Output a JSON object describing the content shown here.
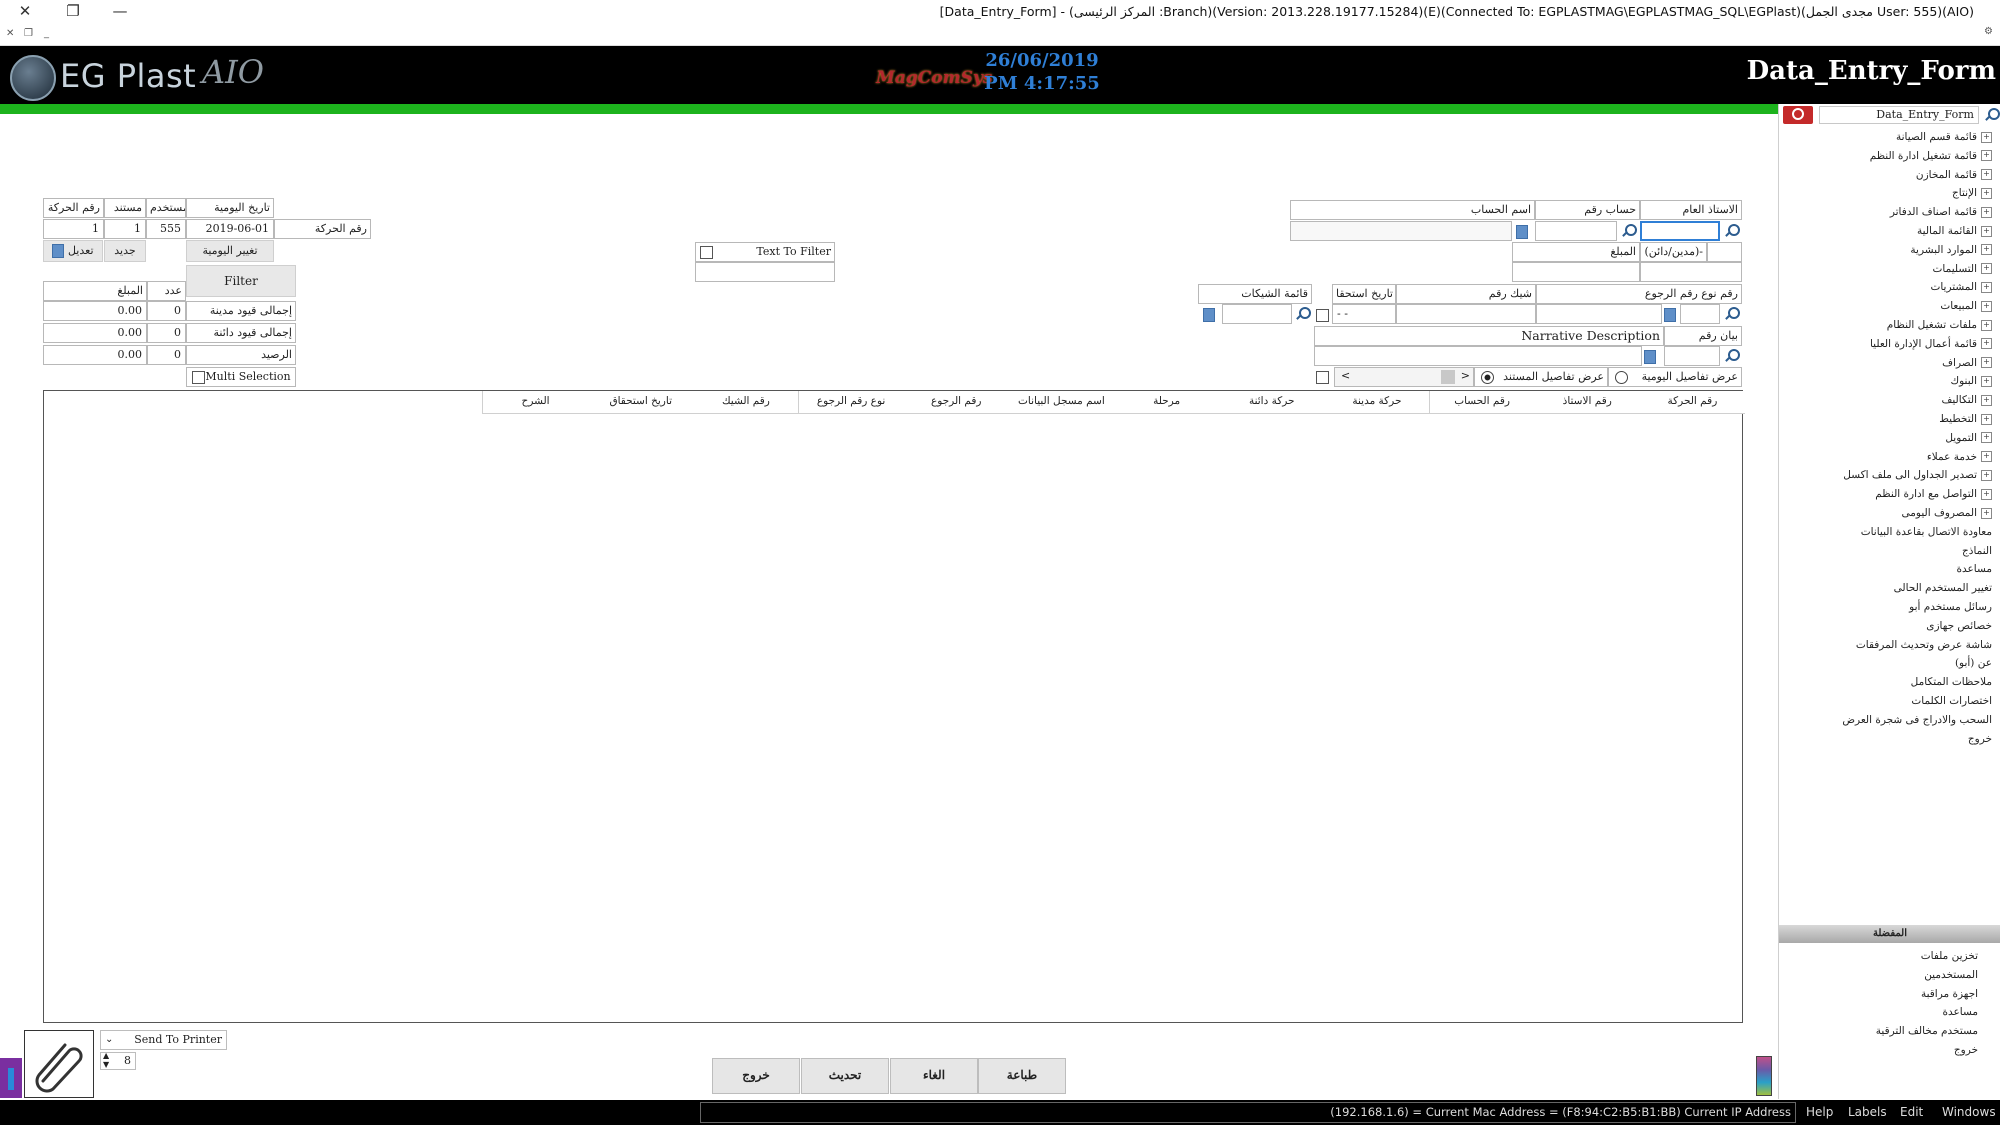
{
  "window": {
    "title": "[Data_Entry_Form] - (المركز الرئيسى :Branch)(Version: 2013.228.19177.15284)(E)(Connected To: EGPLASTMAG\\EGPLASTMAG_SQL\\EGPlast)(مجدى الجمل User: 555)(AIO)",
    "close_glyph": "✕",
    "restore_glyph": "❐",
    "minimize_glyph": "—"
  },
  "header": {
    "logo_text": "EG Plast",
    "logo_script": "AIO",
    "center_logo": "MagComSys",
    "date": "26/06/2019",
    "time": "PM 4:17:55",
    "form_title": "Data_Entry_Form"
  },
  "left_panel": {
    "col_labels": {
      "trans_no": "رقم الحركة",
      "doc": "مستند",
      "user": "مستخدم",
      "journal_date": "تاريخ اليومية"
    },
    "values": {
      "trans_no": "1",
      "doc": "1",
      "user": "555",
      "journal_date": "2019-06-01"
    },
    "trans_no_label": "رقم الحركة",
    "edit_button": "تعديل",
    "new_button": "جديد",
    "change_journal_button": "تغيير اليومية",
    "filter_button": "Filter",
    "amount_header": "المبلغ",
    "count_header": "عدد",
    "summary_rows": [
      {
        "amount": "0.00",
        "count": "0",
        "label": "إجمالى قيود مدينة"
      },
      {
        "amount": "0.00",
        "count": "0",
        "label": "إجمالى قيود دائنة"
      },
      {
        "amount": "0.00",
        "count": "0",
        "label": "الرصيد"
      }
    ],
    "multi_selection": "Multi Selection"
  },
  "text_filter": {
    "label": "Text To Filter",
    "value": ""
  },
  "right_form": {
    "general_ledger": "الاستاذ العام",
    "account_no": "حساب رقم",
    "account_name": "اسم الحساب",
    "debit_credit": "(مدين/دائن)-",
    "amount": "المبلغ",
    "ref_type": "رقم نوع رقم الرجوع",
    "cheque_no": "شيك رقم",
    "due_date": "تاريخ استحقا",
    "due_date_value": "- -",
    "cheque_list": "قائمة الشيكات",
    "statement_no": "بيان رقم",
    "narrative": "Narrative Description",
    "show_journal_details": "عرض تفاصيل اليومية",
    "show_doc_details": "عرض تفاصيل المستند"
  },
  "grid": {
    "columns": [
      "رقم الحركة",
      "رقم الاستاذ",
      "رقم الحساب",
      "حركة مدينة",
      "حركة دائنة",
      "مرحلة",
      "اسم مسجل البيانات",
      "رقم الرجوع",
      "نوع رقم الرجوع",
      "رقم الشيك",
      "تاريخ استحقاق",
      "الشرح"
    ]
  },
  "sidebar": {
    "search_value": "Data_Entry_Form",
    "tree_items": [
      "قائمة قسم الصيانة",
      "قائمة تشغيل ادارة النظم",
      "قائمة المخازن",
      "الإنتاج",
      "قائمة اصناف الدفاتر",
      "القائمة المالية",
      "الموارد البشرية",
      "التسليمات",
      "المشتريات",
      "المبيعات",
      "ملفات تشغيل النظام",
      "قائمة أعمال الإدارة العليا",
      "الصراف",
      "البنوك",
      "التكاليف",
      "التخطيط",
      "التمويل",
      "خدمة عملاء",
      "تصدير الجداول الى ملف اكسل",
      "التواصل مع ادارة النظم",
      "المصروف اليومى",
      "معاودة الاتصال بقاعدة البيانات",
      "النماذج",
      "مساعدة",
      "تغيير المستخدم الحالى",
      "رسائل مستخدم أبو",
      "خصائص جهازى",
      "شاشة عرض وتحديث المرفقات",
      "عن (أبو)",
      "ملاحظات المتكامل",
      "اختصارات الكلمات",
      "السحب والادراج فى شجرة العرض",
      "خروج"
    ],
    "expandable_count": 21,
    "section_title": "المفضلة",
    "favorites": [
      "تخزين ملفات",
      "المستخدمين",
      "اجهزة مراقبة",
      "مساعدة",
      "مستخدم مخالف الترقية",
      "خروج"
    ]
  },
  "bottom": {
    "send_to_printer": "Send To Printer",
    "copies": "8",
    "buttons": {
      "exit": "خروج",
      "refresh": "تحديث",
      "cancel": "الغاء",
      "print": "طباعة"
    }
  },
  "statusbar": {
    "address_text": "(192.168.1.6) = Current Mac Address = (F8:94:C2:B5:B1:BB) Current IP Address",
    "menu": [
      "Help",
      "Labels",
      "Edit",
      "Windows"
    ]
  },
  "colors": {
    "header_bg": "#000000",
    "green_bar": "#1db31d",
    "date_blue": "#2f7fd6",
    "search_red": "#c42a2a"
  }
}
